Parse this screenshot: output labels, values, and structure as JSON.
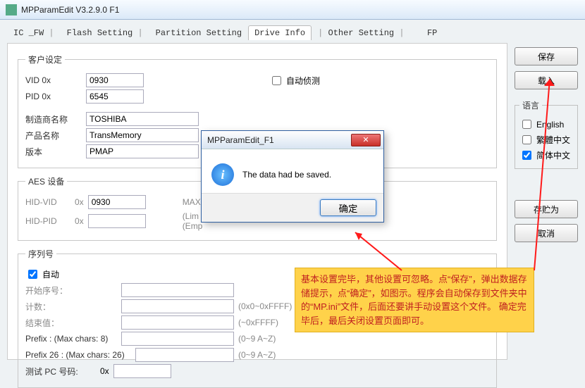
{
  "window": {
    "title": "MPParamEdit V3.2.9.0 F1"
  },
  "tabs": {
    "ic_fw": "IC _FW",
    "flash": "Flash Setting",
    "partition": "Partition Setting",
    "drive": "Drive Info",
    "other": "Other Setting",
    "fp": "FP"
  },
  "customer": {
    "legend": "客户设定",
    "vid_label": "VID   0x",
    "vid": "0930",
    "pid_label": "PID   0x",
    "pid": "6545",
    "auto_detect": "自动侦测",
    "vendor_label": "制造商名称",
    "vendor": "TOSHIBA",
    "product_label": "产品名称",
    "product": "TransMemory",
    "version_label": "版本",
    "version": "PMAP"
  },
  "aes": {
    "legend": "AES 设备",
    "hidvid_label": "HID-VID",
    "hex": "0x",
    "hidvid": "0930",
    "hidpid_label": "HID-PID",
    "hidpid": "",
    "max_label": "MAX",
    "lim": "(Lim",
    "emp": "(Emp"
  },
  "serial": {
    "legend": "序列号",
    "auto": "自动",
    "start_label": "开始序号：",
    "start": "",
    "count_label": "计数：",
    "count": "",
    "count_hint": "(0x0~0xFFFF)",
    "end_label": "结束值：",
    "end": "",
    "end_hint": "(~0xFFFF)",
    "prefix_label": "Prefix : (Max chars: 8)",
    "prefix": "",
    "prefix_hint": "(0~9 A~Z)",
    "prefix26_label": "Prefix 26 : (Max chars: 26)",
    "prefix26": "",
    "prefix26_hint": "(0~9 A~Z)",
    "testpc_label": "测试 PC 号码:",
    "testpc_hex": "0x",
    "testpc": ""
  },
  "right": {
    "save": "保存",
    "load": "载入",
    "lang_legend": "语言",
    "english": "English",
    "trad": "繁體中文",
    "simp": "简体中文",
    "saveas": "存贮为",
    "cancel": "取消"
  },
  "modal": {
    "title": "MPParamEdit_F1",
    "message": "The data had be saved.",
    "ok": "确定"
  },
  "note": {
    "text": "基本设置完毕，其他设置可忽略。点“保存”，弹出数据存储提示，点“确定”，如图示。程序会自动保存到文件夹中的“MP.ini”文件，后面还要讲手动设置这个文件。 确定完毕后，最后关闭设置页面即可。"
  }
}
